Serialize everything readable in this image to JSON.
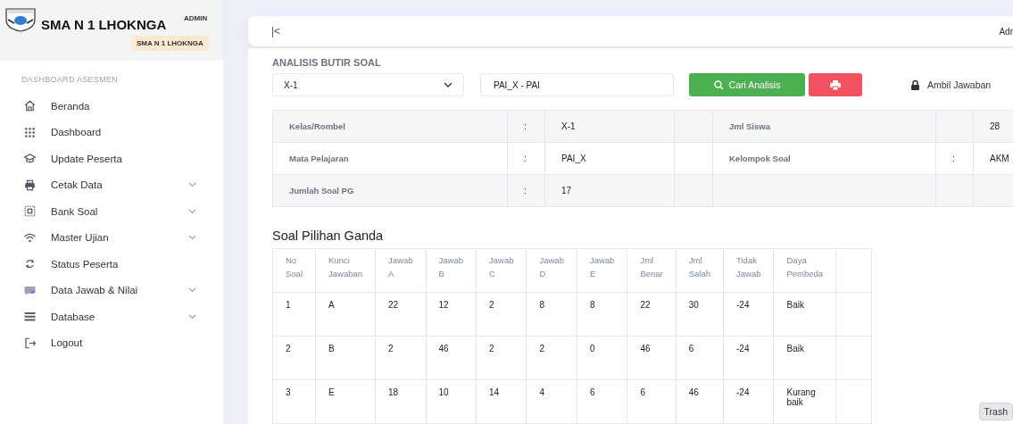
{
  "sidebar": {
    "title": "SMA N 1 LHOKNGA",
    "role": "ADMIN",
    "school_badge": "SMA N 1 LHOKNGA",
    "section": "DASHBOARD ASESMEN",
    "items": [
      {
        "label": "Beranda",
        "has_submenu": false
      },
      {
        "label": "Dashboard",
        "has_submenu": false
      },
      {
        "label": "Update Peserta",
        "has_submenu": false
      },
      {
        "label": "Cetak Data",
        "has_submenu": true
      },
      {
        "label": "Bank Soal",
        "has_submenu": true
      },
      {
        "label": "Master Ujian",
        "has_submenu": true
      },
      {
        "label": "Status Peserta",
        "has_submenu": false
      },
      {
        "label": "Data Jawab & Nilai",
        "has_submenu": true
      },
      {
        "label": "Database",
        "has_submenu": true
      },
      {
        "label": "Logout",
        "has_submenu": false
      }
    ]
  },
  "topbar": {
    "collapse": "|<",
    "user": "Adr"
  },
  "page_title": "ANALISIS BUTIR SOAL",
  "filters": {
    "class_select": "X-1",
    "subject_field": "PAI_X - PAI",
    "search_button": "Cari Analisis",
    "lock_text": "Ambil Jawaban"
  },
  "info_table": [
    {
      "label": "Kelas/Rombel",
      "colon": ":",
      "value": "X-1",
      "label_2": "Jml Siswa",
      "value_2": "28"
    },
    {
      "label": "Mata Pelajaran",
      "colon": ":",
      "value": "PAI_X",
      "label_2": "Kelompok Soal",
      "colon_2": ":",
      "value_2": "AKM"
    },
    {
      "label": "Jumlah Soal PG",
      "colon": ":",
      "value": "17"
    }
  ],
  "section_title": "Soal Pilihan Ganda",
  "table": {
    "columns": [
      "No Soal",
      "Kunci Jawaban",
      "Jawab A",
      "Jawab B",
      "Jawab C",
      "Jawab D",
      "Jawab E",
      "Jml Benar",
      "Jml Salah",
      "Tidak Jawab",
      "Daya Pembeda"
    ],
    "rows": [
      [
        "1",
        "A",
        "22",
        "12",
        "2",
        "8",
        "8",
        "22",
        "30",
        "-24",
        "Baik"
      ],
      [
        "2",
        "B",
        "2",
        "46",
        "2",
        "2",
        "0",
        "46",
        "6",
        "-24",
        "Baik"
      ],
      [
        "3",
        "E",
        "18",
        "10",
        "14",
        "4",
        "6",
        "6",
        "46",
        "-24",
        "Kurang baik"
      ]
    ]
  },
  "tooltip": "Trash"
}
